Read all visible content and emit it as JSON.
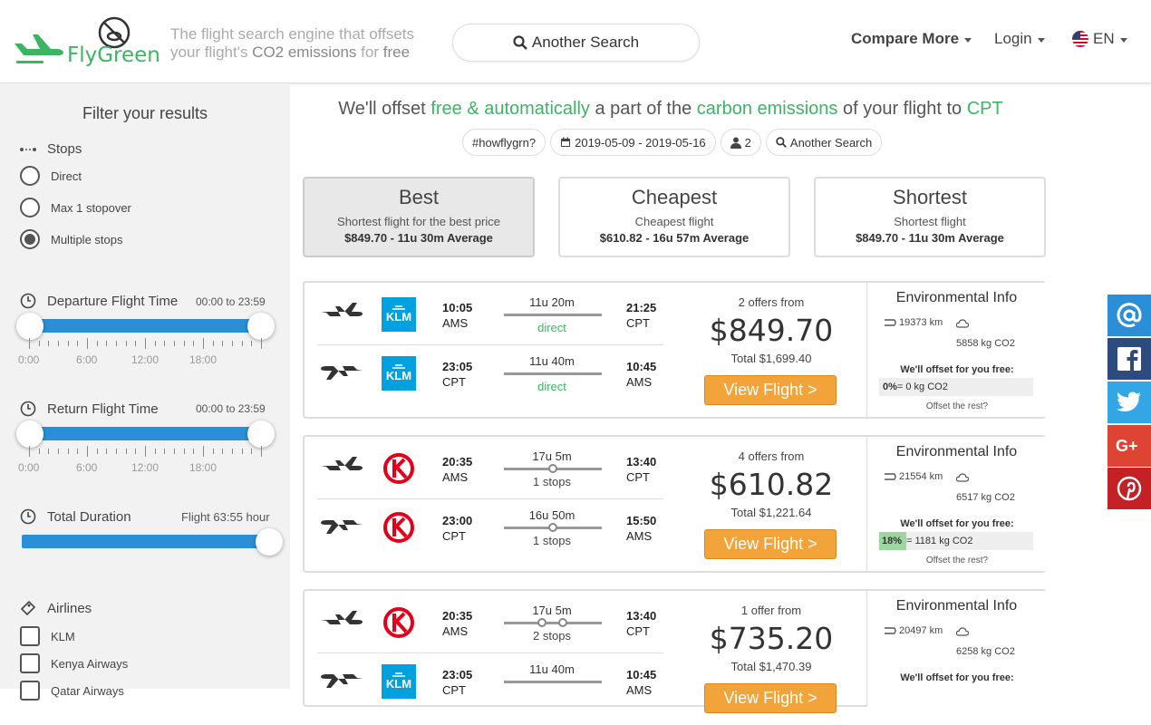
{
  "header": {
    "brand": "FlyGreen",
    "tagline_prefix": "The flight search engine that offsets your flight's ",
    "tagline_bold": "CO2 emissions",
    "tagline_mid": " for ",
    "tagline_end": "free",
    "search_label": "Another Search",
    "nav": {
      "compare": "Compare More",
      "login": "Login",
      "lang": "EN"
    }
  },
  "sidebar": {
    "title": "Filter your results",
    "stops": {
      "label": "Stops",
      "options": [
        "Direct",
        "Max 1 stopover",
        "Multiple stops"
      ],
      "selected": "Multiple stops"
    },
    "departure": {
      "label": "Departure Flight Time",
      "range": "00:00 to 23:59",
      "ticks": [
        "0:00",
        "6:00",
        "12:00",
        "18:00"
      ]
    },
    "return": {
      "label": "Return Flight Time",
      "range": "00:00 to 23:59",
      "ticks": [
        "0:00",
        "6:00",
        "12:00",
        "18:00"
      ]
    },
    "duration": {
      "label": "Total Duration",
      "value": "Flight 63:55 hour"
    },
    "airlines": {
      "label": "Airlines",
      "items": [
        "KLM",
        "Kenya Airways",
        "Qatar Airways"
      ]
    }
  },
  "main": {
    "headline": {
      "a": "We'll offset ",
      "b": "free & automatically",
      "c": " a part of the ",
      "d": "carbon emissions",
      "e": " of your flight to ",
      "f": "CPT"
    },
    "chips": {
      "how": "#howflygrn?",
      "dates": "2019-05-09 - 2019-05-16",
      "pax": "2",
      "search": "Another Search"
    },
    "sort": [
      {
        "title": "Best",
        "sub": "Shortest flight for the best price",
        "price": "$849.70 - 11u 30m Average"
      },
      {
        "title": "Cheapest",
        "sub": "Cheapest flight",
        "price": "$610.82 - 16u 57m Average"
      },
      {
        "title": "Shortest",
        "sub": "Shortest flight",
        "price": "$849.70 - 11u 30m Average"
      }
    ],
    "results": [
      {
        "out": {
          "dep_time": "10:05",
          "dep": "AMS",
          "dur": "11u 20m",
          "stops": "direct",
          "arr_time": "21:25",
          "arr": "CPT"
        },
        "ret": {
          "dep_time": "23:05",
          "dep": "CPT",
          "dur": "11u 40m",
          "stops": "direct",
          "arr_time": "10:45",
          "arr": "AMS"
        },
        "offers": "2 offers from",
        "price": "$849.70",
        "total": "Total $1,699.40",
        "btn": "View Flight >",
        "env": {
          "title": "Environmental Info",
          "km": "19373 km",
          "co2": "5858 kg CO2",
          "offset_label": "We'll offset for you free:",
          "pct": "0%",
          "offset_text": " = 0 kg CO2",
          "offset_fraction": 0,
          "rest": "Offset the rest?"
        }
      },
      {
        "out": {
          "dep_time": "20:35",
          "dep": "AMS",
          "dur": "17u 5m",
          "stops": "1 stops",
          "arr_time": "13:40",
          "arr": "CPT"
        },
        "ret": {
          "dep_time": "23:00",
          "dep": "CPT",
          "dur": "16u 50m",
          "stops": "1 stops",
          "arr_time": "15:50",
          "arr": "AMS"
        },
        "offers": "4 offers from",
        "price": "$610.82",
        "total": "Total $1,221.64",
        "btn": "View Flight >",
        "env": {
          "title": "Environmental Info",
          "km": "21554 km",
          "co2": "6517 kg CO2",
          "offset_label": "We'll offset for you free:",
          "pct": "18%",
          "offset_text": " = 1181 kg CO2",
          "offset_fraction": 0.18,
          "rest": "Offset the rest?"
        }
      },
      {
        "out": {
          "dep_time": "20:35",
          "dep": "AMS",
          "dur": "17u 5m",
          "stops": "2 stops",
          "arr_time": "13:40",
          "arr": "CPT"
        },
        "ret": {
          "dep_time": "23:05",
          "dep": "CPT",
          "dur": "11u 40m",
          "stops": "",
          "arr_time": "10:45",
          "arr": "AMS"
        },
        "offers": "1 offer from",
        "price": "$735.20",
        "total": "Total $1,470.39",
        "btn": "View Flight >",
        "env": {
          "title": "Environmental Info",
          "km": "20497 km",
          "co2": "6258 kg CO2",
          "offset_label": "We'll offset for you free:"
        }
      }
    ]
  },
  "colors": {
    "brand_green": "#3cb563",
    "slider_blue": "#2a8fd6",
    "button_orange": "#f2a33a",
    "klm_blue": "#00a1de",
    "kenya_red": "#e3001b"
  }
}
